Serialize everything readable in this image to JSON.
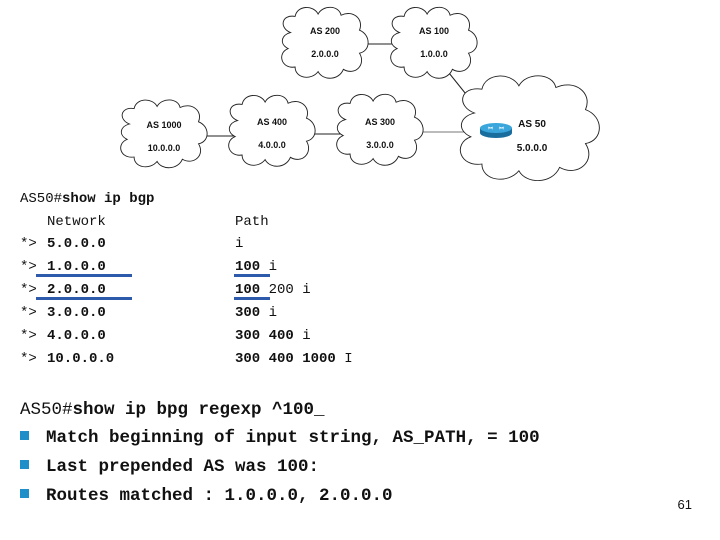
{
  "diagram": {
    "clouds": [
      {
        "id": "as200",
        "as_label": "AS 200",
        "network": "2.0.0.0"
      },
      {
        "id": "as100",
        "as_label": "AS 100",
        "network": "1.0.0.0"
      },
      {
        "id": "as1000",
        "as_label": "AS 1000",
        "network": "10.0.0.0"
      },
      {
        "id": "as400",
        "as_label": "AS 400",
        "network": "4.0.0.0"
      },
      {
        "id": "as300",
        "as_label": "AS 300",
        "network": "3.0.0.0"
      },
      {
        "id": "as50",
        "as_label": "AS 50",
        "network": "5.0.0.0"
      }
    ],
    "links": [
      [
        "as200",
        "as100"
      ],
      [
        "as1000",
        "as400"
      ],
      [
        "as400",
        "as300"
      ],
      [
        "as300",
        "as50"
      ],
      [
        "as100",
        "as50"
      ]
    ],
    "router_icon": "router-icon",
    "colors": {
      "router": "#1f8fc7",
      "outline": "#222222"
    }
  },
  "show_bgp": {
    "prompt": "AS50#",
    "command": "show ip bgp",
    "headers": {
      "network": "Network",
      "path": "Path"
    },
    "rows": [
      {
        "status": "*>",
        "network": "5.0.0.0",
        "path_as": "",
        "path_rest": "i",
        "highlight": false
      },
      {
        "status": "*>",
        "network": "1.0.0.0",
        "path_as": "100",
        "path_rest": " i",
        "highlight": true
      },
      {
        "status": "*>",
        "network": "2.0.0.0",
        "path_as": "100",
        "path_rest": " 200 i",
        "highlight": true
      },
      {
        "status": "*>",
        "network": "3.0.0.0",
        "path_as": "300",
        "path_rest": " i",
        "highlight": false
      },
      {
        "status": "*>",
        "network": "4.0.0.0",
        "path_as": "300 400",
        "path_rest": " i",
        "highlight": false
      },
      {
        "status": "*>",
        "network": "10.0.0.0",
        "path_as": "300 400 1000",
        "path_rest": " I",
        "highlight": false
      }
    ],
    "highlight_color": "#2e5aac"
  },
  "regexp": {
    "prompt": "AS50#",
    "command": "show ip bpg regexp ^100_",
    "bullets": [
      "Match beginning of input string, AS_PATH, = 100",
      "Last prepended AS was 100:",
      "Routes matched : 1.0.0.0, 2.0.0.0"
    ],
    "bullet_color": "#1e8fc8"
  },
  "page_number": "61"
}
